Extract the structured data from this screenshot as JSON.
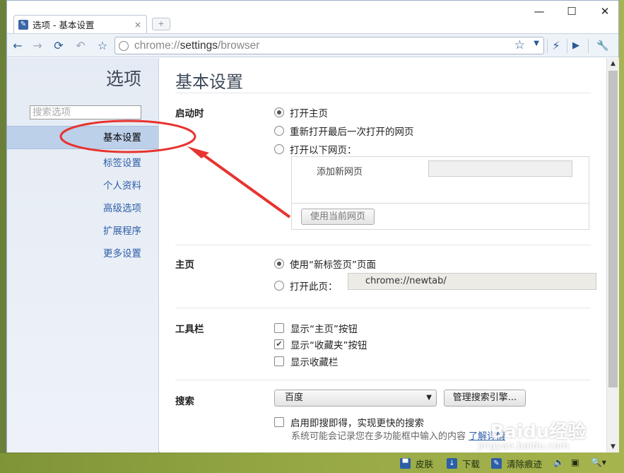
{
  "window": {
    "tab_title": "选项 - 基本设置",
    "tab_close": "×",
    "new_tab": "+",
    "controls": {
      "minimize": "—",
      "maximize": "☐",
      "close": "✕"
    }
  },
  "toolbar": {
    "back": "←",
    "forward": "→",
    "reload": "⟳",
    "undo": "↶",
    "bookmark": "☆",
    "url_scheme": "chrome://",
    "url_host": "settings",
    "url_path": "/browser",
    "star": "☆",
    "dropdown": "▼",
    "flash": "⚡",
    "play": "▶",
    "wrench": "🔧"
  },
  "sidebar": {
    "title": "选项",
    "search_placeholder": "搜索选项",
    "items": [
      {
        "label": "基本设置",
        "active": true
      },
      {
        "label": "标签设置"
      },
      {
        "label": "个人资料"
      },
      {
        "label": "高级选项"
      },
      {
        "label": "扩展程序"
      },
      {
        "label": "更多设置"
      }
    ]
  },
  "content": {
    "title": "基本设置",
    "startup": {
      "label": "启动时",
      "options": [
        "打开主页",
        "重新打开最后一次打开的网页",
        "打开以下网页："
      ],
      "selected": 0,
      "add_page_label": "添加新网页",
      "use_current_button": "使用当前网页"
    },
    "homepage": {
      "label": "主页",
      "options": [
        "使用“新标签页”页面",
        "打开此页："
      ],
      "selected": 0,
      "url_value": "chrome://newtab/"
    },
    "toolbar_section": {
      "label": "工具栏",
      "options": [
        {
          "label": "显示“主页”按钮",
          "checked": false
        },
        {
          "label": "显示“收藏夹”按钮",
          "checked": true
        },
        {
          "label": "显示收藏栏",
          "checked": false
        }
      ]
    },
    "search": {
      "label": "搜索",
      "engine": "百度",
      "manage_button": "管理搜索引擎...",
      "instant_label": "启用即搜即得，实现更快的搜索",
      "instant_checked": false,
      "note": "系统可能会记录您在多功能框中输入的内容",
      "learn_more": "了解详情"
    }
  },
  "statusbar": {
    "skin": "皮肤",
    "download": "下载",
    "clear": "清除痕迹"
  },
  "watermark": {
    "brand": "Baidu经验",
    "site": "jingyan.baidu.com"
  },
  "colors": {
    "accent": "#2d5ea8",
    "active_nav": "#bdd0ea",
    "annotation": "#e8332f"
  }
}
